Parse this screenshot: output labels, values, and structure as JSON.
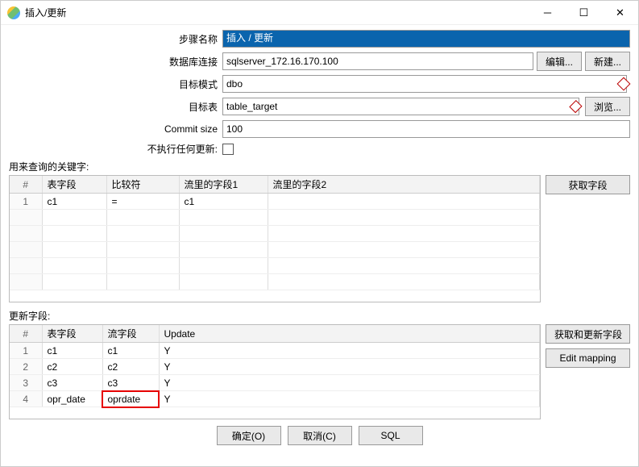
{
  "window": {
    "title": "插入/更新"
  },
  "form": {
    "step_name_label": "步骤名称",
    "step_name_value": "插入 / 更新",
    "connection_label": "数据库连接",
    "connection_value": "sqlserver_172.16.170.100",
    "edit_btn": "编辑...",
    "new_btn": "新建...",
    "schema_label": "目标模式",
    "schema_value": "dbo",
    "table_label": "目标表",
    "table_value": "table_target",
    "browse_btn": "浏览...",
    "commit_label": "Commit size",
    "commit_value": "100",
    "noupdate_label": "不执行任何更新:"
  },
  "keys": {
    "section_label": "用来查询的关键字:",
    "get_fields_btn": "获取字段",
    "headers": {
      "num": "#",
      "table_field": "表字段",
      "comparator": "比较符",
      "stream1": "流里的字段1",
      "stream2": "流里的字段2"
    },
    "rows": [
      {
        "num": "1",
        "table_field": "c1",
        "comparator": "=",
        "stream1": "c1",
        "stream2": ""
      }
    ]
  },
  "updates": {
    "section_label": "更新字段:",
    "get_upd_btn": "获取和更新字段",
    "edit_map_btn": "Edit mapping",
    "headers": {
      "num": "#",
      "table_field": "表字段",
      "stream_field": "流字段",
      "update": "Update"
    },
    "rows": [
      {
        "num": "1",
        "table_field": "c1",
        "stream_field": "c1",
        "update": "Y"
      },
      {
        "num": "2",
        "table_field": "c2",
        "stream_field": "c2",
        "update": "Y"
      },
      {
        "num": "3",
        "table_field": "c3",
        "stream_field": "c3",
        "update": "Y"
      },
      {
        "num": "4",
        "table_field": "opr_date",
        "stream_field": "oprdate",
        "update": "Y"
      }
    ]
  },
  "buttons": {
    "ok": "确定(O)",
    "cancel": "取消(C)",
    "sql": "SQL"
  }
}
